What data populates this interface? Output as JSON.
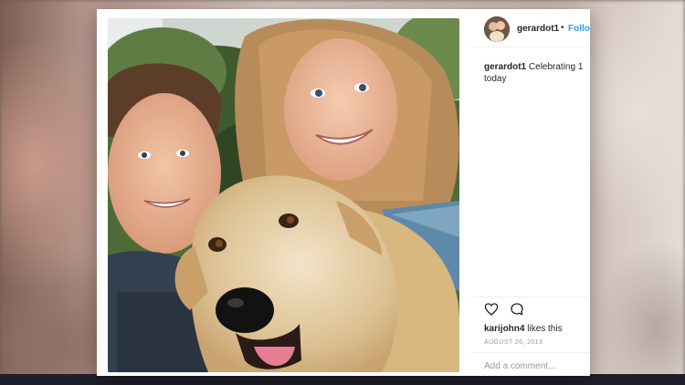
{
  "post": {
    "username": "gerardot1",
    "separator": "•",
    "follow_label": "Follo",
    "caption": {
      "user": "gerardot1",
      "text_line1": "Celebrating 1",
      "text_line2": "today"
    },
    "likes": {
      "liker": "karijohn4",
      "suffix": "likes this"
    },
    "date": "AUGUST 26, 2013",
    "comment_placeholder": "Add a comment..."
  },
  "icons": {
    "like": "heart-icon",
    "comment": "comment-icon"
  },
  "colors": {
    "follow": "#3897f0",
    "text": "#262626",
    "muted": "#999999"
  }
}
